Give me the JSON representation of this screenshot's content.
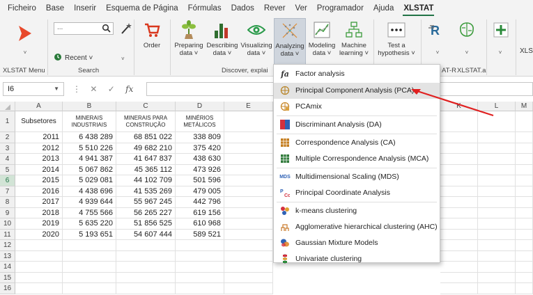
{
  "menu_tabs": [
    "Ficheiro",
    "Base",
    "Inserir",
    "Esquema de Página",
    "Fórmulas",
    "Dados",
    "Rever",
    "Ver",
    "Programador",
    "Ajuda",
    "XLSTAT"
  ],
  "ribbon": {
    "search_placeholder": "...",
    "recent_label": "Recent ˅",
    "order_label": "Order",
    "group_xlstat_menu": "XLSTAT Menu",
    "group_search": "Search",
    "group_discover": "Discover, explai",
    "group_atr": "AT-R",
    "group_xlstat_ai": "XLSTAT.ai",
    "buttons": [
      {
        "line1": "Preparing",
        "line2": "data ˅"
      },
      {
        "line1": "Describing",
        "line2": "data ˅"
      },
      {
        "line1": "Visualizing",
        "line2": "data ˅"
      },
      {
        "line1": "Analyzing",
        "line2": "data ˅"
      },
      {
        "line1": "Modeling",
        "line2": "data ˅"
      },
      {
        "line1": "Machine",
        "line2": "learning ˅"
      },
      {
        "line1": "Test a",
        "line2": "hypothesis ˅"
      }
    ],
    "xls_cut": "XLS"
  },
  "formula_bar": {
    "name_box": "I6",
    "fx": "fx"
  },
  "columns": [
    "A",
    "B",
    "C",
    "D",
    "E",
    "K",
    "L",
    "M"
  ],
  "headers": {
    "a": "Subsetores",
    "b": "MINERAIS INDUSTRIAIS",
    "c": "MINERAIS PARA CONSTRUÇÃO",
    "d": "MINÉRIOS METÁLICOS"
  },
  "rows": [
    {
      "n": "2",
      "a": "2011",
      "b": "6 438 289",
      "c": "68 851 022",
      "d": "338 809"
    },
    {
      "n": "3",
      "a": "2012",
      "b": "5 510 226",
      "c": "49 682 210",
      "d": "375 420"
    },
    {
      "n": "4",
      "a": "2013",
      "b": "4 941 387",
      "c": "41 647 837",
      "d": "438 630"
    },
    {
      "n": "5",
      "a": "2014",
      "b": "5 067 862",
      "c": "45 365 112",
      "d": "473 926"
    },
    {
      "n": "6",
      "a": "2015",
      "b": "5 029 081",
      "c": "44 102 709",
      "d": "501 596"
    },
    {
      "n": "7",
      "a": "2016",
      "b": "4 438 696",
      "c": "41 535 269",
      "d": "479 005"
    },
    {
      "n": "8",
      "a": "2017",
      "b": "4 939 644",
      "c": "55 967 245",
      "d": "442 796"
    },
    {
      "n": "9",
      "a": "2018",
      "b": "4 755 566",
      "c": "56 265 227",
      "d": "619 156"
    },
    {
      "n": "10",
      "a": "2019",
      "b": "5 635 220",
      "c": "51 856 525",
      "d": "610 968"
    },
    {
      "n": "11",
      "a": "2020",
      "b": "5 193 651",
      "c": "54 607 444",
      "d": "589 521"
    }
  ],
  "row_numbers": [
    "1",
    "12",
    "13",
    "14",
    "15",
    "16"
  ],
  "dropdown": [
    {
      "label": "Factor analysis",
      "icon": "fa-icon"
    },
    {
      "label": "Principal Component Analysis (PCA)",
      "icon": "pca-icon"
    },
    {
      "label": "PCAmix",
      "icon": "pcamix-icon"
    },
    {
      "label": "Discriminant Analysis (DA)",
      "icon": "da-icon"
    },
    {
      "label": "Correspondence Analysis (CA)",
      "icon": "ca-icon"
    },
    {
      "label": "Multiple Correspondence Analysis (MCA)",
      "icon": "mca-icon"
    },
    {
      "label": "Multidimensional Scaling (MDS)",
      "icon": "mds-icon"
    },
    {
      "label": "Principal Coordinate Analysis",
      "icon": "pcoa-icon"
    },
    {
      "label": "k-means clustering",
      "icon": "kmeans-icon"
    },
    {
      "label": "Agglomerative hierarchical clustering (AHC)",
      "icon": "ahc-icon"
    },
    {
      "label": "Gaussian Mixture Models",
      "icon": "gmm-icon"
    },
    {
      "label": "Univariate clustering",
      "icon": "univariate-icon"
    }
  ],
  "colors": {
    "accent": "#217346",
    "arrow": "#e02020",
    "hover": "#e3e3e3"
  }
}
